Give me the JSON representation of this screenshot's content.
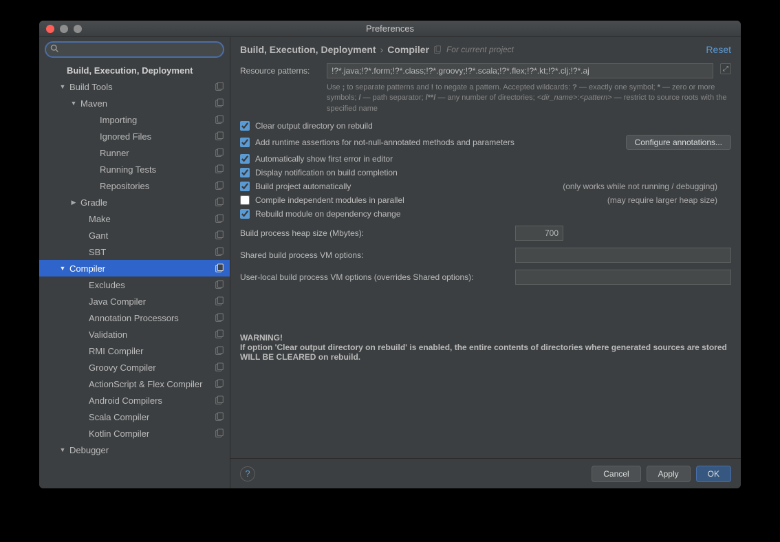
{
  "window": {
    "title": "Preferences"
  },
  "search": {
    "placeholder": ""
  },
  "breadcrumb": {
    "segments": [
      "Build, Execution, Deployment",
      "Compiler"
    ],
    "hint": "For current project",
    "reset": "Reset"
  },
  "sidebar": {
    "items": [
      {
        "label": "Build, Execution, Deployment",
        "indent": 24,
        "arrow": "",
        "bold": true,
        "copy": false
      },
      {
        "label": "Build Tools",
        "indent": 28,
        "arrow": "▼",
        "bold": false,
        "copy": true
      },
      {
        "label": "Maven",
        "indent": 44,
        "arrow": "▼",
        "bold": false,
        "copy": true
      },
      {
        "label": "Importing",
        "indent": 72,
        "arrow": "",
        "bold": false,
        "copy": true
      },
      {
        "label": "Ignored Files",
        "indent": 72,
        "arrow": "",
        "bold": false,
        "copy": true
      },
      {
        "label": "Runner",
        "indent": 72,
        "arrow": "",
        "bold": false,
        "copy": true
      },
      {
        "label": "Running Tests",
        "indent": 72,
        "arrow": "",
        "bold": false,
        "copy": true
      },
      {
        "label": "Repositories",
        "indent": 72,
        "arrow": "",
        "bold": false,
        "copy": true
      },
      {
        "label": "Gradle",
        "indent": 44,
        "arrow": "▶",
        "bold": false,
        "copy": true
      },
      {
        "label": "Make",
        "indent": 56,
        "arrow": "",
        "bold": false,
        "copy": true
      },
      {
        "label": "Gant",
        "indent": 56,
        "arrow": "",
        "bold": false,
        "copy": true
      },
      {
        "label": "SBT",
        "indent": 56,
        "arrow": "",
        "bold": false,
        "copy": true
      },
      {
        "label": "Compiler",
        "indent": 28,
        "arrow": "▼",
        "bold": false,
        "copy": true,
        "selected": true
      },
      {
        "label": "Excludes",
        "indent": 56,
        "arrow": "",
        "bold": false,
        "copy": true
      },
      {
        "label": "Java Compiler",
        "indent": 56,
        "arrow": "",
        "bold": false,
        "copy": true
      },
      {
        "label": "Annotation Processors",
        "indent": 56,
        "arrow": "",
        "bold": false,
        "copy": true
      },
      {
        "label": "Validation",
        "indent": 56,
        "arrow": "",
        "bold": false,
        "copy": true
      },
      {
        "label": "RMI Compiler",
        "indent": 56,
        "arrow": "",
        "bold": false,
        "copy": true
      },
      {
        "label": "Groovy Compiler",
        "indent": 56,
        "arrow": "",
        "bold": false,
        "copy": true
      },
      {
        "label": "ActionScript & Flex Compiler",
        "indent": 56,
        "arrow": "",
        "bold": false,
        "copy": true
      },
      {
        "label": "Android Compilers",
        "indent": 56,
        "arrow": "",
        "bold": false,
        "copy": true
      },
      {
        "label": "Scala Compiler",
        "indent": 56,
        "arrow": "",
        "bold": false,
        "copy": true
      },
      {
        "label": "Kotlin Compiler",
        "indent": 56,
        "arrow": "",
        "bold": false,
        "copy": true
      },
      {
        "label": "Debugger",
        "indent": 28,
        "arrow": "▼",
        "bold": false,
        "copy": false
      }
    ]
  },
  "form": {
    "resource_label": "Resource patterns:",
    "resource_value": "!?*.java;!?*.form;!?*.class;!?*.groovy;!?*.scala;!?*.flex;!?*.kt;!?*.clj;!?*.aj",
    "help_html": "Use ; to separate patterns and ! to negate a pattern. Accepted wildcards: ? — exactly one symbol; * — zero or more symbols; / — path separator; /**/ — any number of directories; <dir_name>:<pattern> — restrict to source roots with the specified name",
    "checks": [
      {
        "label": "Clear output directory on rebuild",
        "checked": true,
        "aside": "",
        "button": ""
      },
      {
        "label": "Add runtime assertions for not-null-annotated methods and parameters",
        "checked": true,
        "aside": "",
        "button": "Configure annotations..."
      },
      {
        "label": "Automatically show first error in editor",
        "checked": true,
        "aside": "",
        "button": ""
      },
      {
        "label": "Display notification on build completion",
        "checked": true,
        "aside": "",
        "button": ""
      },
      {
        "label": "Build project automatically",
        "checked": true,
        "aside": "(only works while not running / debugging)",
        "button": ""
      },
      {
        "label": "Compile independent modules in parallel",
        "checked": false,
        "aside": "(may require larger heap size)",
        "button": ""
      },
      {
        "label": "Rebuild module on dependency change",
        "checked": true,
        "aside": "",
        "button": ""
      }
    ],
    "fields": [
      {
        "label": "Build process heap size (Mbytes):",
        "value": "700",
        "short": true
      },
      {
        "label": "Shared build process VM options:",
        "value": "",
        "short": false
      },
      {
        "label": "User-local build process VM options (overrides Shared options):",
        "value": "",
        "short": false
      }
    ],
    "warning_title": "WARNING!",
    "warning_text": "If option 'Clear output directory on rebuild' is enabled, the entire contents of directories where generated sources are stored WILL BE CLEARED on rebuild."
  },
  "footer": {
    "cancel": "Cancel",
    "apply": "Apply",
    "ok": "OK"
  }
}
